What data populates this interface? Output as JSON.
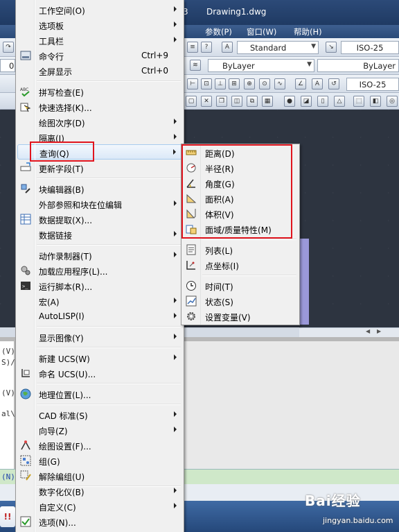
{
  "window": {
    "title": "Drawing1.dwg",
    "title_prefix": "3"
  },
  "menubar": {
    "items": [
      {
        "label": "参数(P)"
      },
      {
        "label": "窗口(W)"
      },
      {
        "label": "帮助(H)"
      }
    ]
  },
  "toolbar": {
    "text_style": "Standard",
    "dim_style": "ISO-25",
    "layer": "ByLayer",
    "linetype": "ByLayer",
    "dim_style2": "ISO-25",
    "partial_zero": "0"
  },
  "command_line": {
    "lines": [
      "(V)",
      "S)/",
      "(V)",
      "al\\"
    ],
    "input_prefix": "(N)"
  },
  "tools_menu": {
    "items": [
      {
        "label": "工作空间(O)",
        "submenu": true
      },
      {
        "label": "选项板",
        "submenu": true
      },
      {
        "label": "工具栏",
        "submenu": true
      },
      {
        "label": "命令行",
        "shortcut": "Ctrl+9",
        "icon": "command-line-icon"
      },
      {
        "label": "全屏显示",
        "shortcut": "Ctrl+0"
      },
      {
        "label": "拼写检查(E)",
        "icon": "spell-check-icon"
      },
      {
        "label": "快速选择(K)...",
        "icon": "quick-select-icon"
      },
      {
        "label": "绘图次序(D)",
        "submenu": true
      },
      {
        "label": "隔离(I)",
        "submenu": true
      },
      {
        "label": "查询(Q)",
        "submenu": true,
        "highlighted": true
      },
      {
        "label": "更新字段(T)",
        "icon": "update-field-icon"
      },
      {
        "label": "块编辑器(B)",
        "icon": "block-editor-icon"
      },
      {
        "label": "外部参照和块在位编辑",
        "submenu": true
      },
      {
        "label": "数据提取(X)...",
        "icon": "data-extract-icon"
      },
      {
        "label": "数据链接",
        "submenu": true
      },
      {
        "label": "动作录制器(T)",
        "submenu": true
      },
      {
        "label": "加载应用程序(L)...",
        "icon": "load-app-icon"
      },
      {
        "label": "运行脚本(R)...",
        "icon": "run-script-icon"
      },
      {
        "label": "宏(A)",
        "submenu": true
      },
      {
        "label": "AutoLISP(I)",
        "submenu": true
      },
      {
        "label": "显示图像(Y)",
        "submenu": true
      },
      {
        "label": "新建 UCS(W)",
        "submenu": true
      },
      {
        "label": "命名 UCS(U)...",
        "icon": "named-ucs-icon"
      },
      {
        "label": "地理位置(L)...",
        "icon": "geo-location-icon"
      },
      {
        "label": "CAD 标准(S)",
        "submenu": true
      },
      {
        "label": "向导(Z)",
        "submenu": true
      },
      {
        "label": "绘图设置(F)...",
        "icon": "drafting-settings-icon"
      },
      {
        "label": "组(G)",
        "icon": "group-icon"
      },
      {
        "label": "解除编组(U)",
        "icon": "ungroup-icon"
      },
      {
        "label": "数字化仪(B)",
        "submenu": true
      },
      {
        "label": "自定义(C)",
        "submenu": true
      },
      {
        "label": "选项(N)...",
        "icon": "options-icon"
      }
    ]
  },
  "inquiry_submenu": {
    "items": [
      {
        "label": "距离(D)",
        "icon": "distance-icon"
      },
      {
        "label": "半径(R)",
        "icon": "radius-icon"
      },
      {
        "label": "角度(G)",
        "icon": "angle-icon"
      },
      {
        "label": "面积(A)",
        "icon": "area-icon"
      },
      {
        "label": "体积(V)",
        "icon": "volume-icon"
      },
      {
        "label": "面域/质量特性(M)",
        "icon": "mass-properties-icon"
      },
      {
        "label": "列表(L)",
        "icon": "list-icon"
      },
      {
        "label": "点坐标(I)",
        "icon": "point-coordinate-icon"
      },
      {
        "label": "时间(T)",
        "icon": "time-icon"
      },
      {
        "label": "状态(S)",
        "icon": "status-icon"
      },
      {
        "label": "设置变量(V)",
        "icon": "set-variable-icon"
      }
    ]
  },
  "watermark": {
    "brand": "Bai经验",
    "url": "jingyan.baidu.com"
  },
  "taskbar": {
    "start_glyph": "!!"
  },
  "colors": {
    "highlight_box": "#e0141e",
    "menu_bg": "#f0f0f0",
    "hover_border": "#a8cbee"
  }
}
